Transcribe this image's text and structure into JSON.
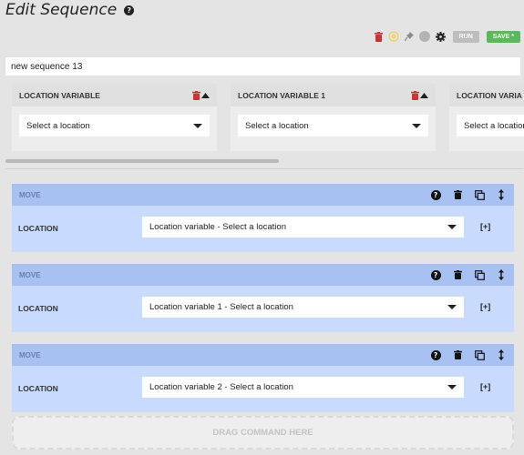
{
  "header": {
    "title": "Edit Sequence",
    "help_glyph": "?"
  },
  "toolbar": {
    "icons": [
      "trash-icon",
      "sun-icon",
      "pin-icon",
      "status-dot-icon",
      "gear-icon"
    ],
    "colors": {
      "trash": "#cc3333",
      "sun": "#f3d36b",
      "pin": "#8a8a8a",
      "status": "#b3b3b3",
      "run": "#bdbdbd",
      "save": "#5cb85c"
    },
    "run_label": "RUN",
    "save_label": "SAVE *"
  },
  "sequence_name": {
    "value": "new sequence 13"
  },
  "variables": [
    {
      "title": "LOCATION VARIABLE",
      "value": "Select a location"
    },
    {
      "title": "LOCATION VARIABLE 1",
      "value": "Select a location"
    },
    {
      "title": "LOCATION VARIA",
      "value": "Select a location"
    }
  ],
  "steps": [
    {
      "title": "MOVE",
      "field_label": "LOCATION",
      "value": "Location variable - Select a location",
      "add_label": "[+]"
    },
    {
      "title": "MOVE",
      "field_label": "LOCATION",
      "value": "Location variable 1 - Select a location",
      "add_label": "[+]"
    },
    {
      "title": "MOVE",
      "field_label": "LOCATION",
      "value": "Location variable 2 - Select a location",
      "add_label": "[+]"
    }
  ],
  "step_icons": [
    "help-icon",
    "trash-icon",
    "copy-icon",
    "drag-handle-icon"
  ],
  "drop_zone": {
    "label": "DRAG COMMAND HERE"
  },
  "colors": {
    "step_head": "#a7c1f2",
    "step_body": "#c9daff",
    "delete_red": "#cc3333"
  }
}
